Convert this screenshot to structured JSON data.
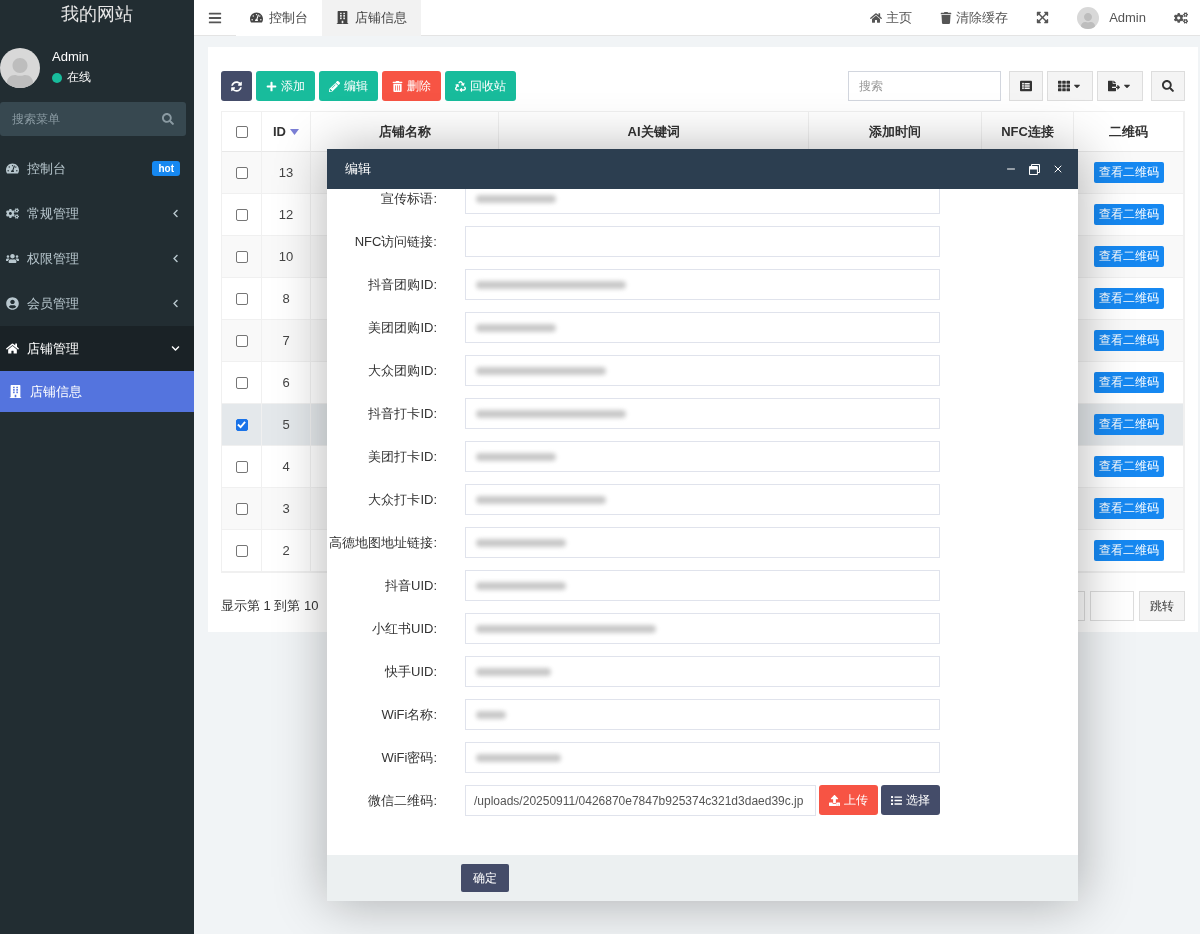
{
  "sidebar": {
    "logo": "我的网站",
    "user": {
      "name": "Admin",
      "status": "在线"
    },
    "search": {
      "placeholder": "搜索菜单"
    },
    "menu": [
      {
        "label": "控制台",
        "kind": "link",
        "badge": "hot"
      },
      {
        "label": "常规管理",
        "kind": "group",
        "expanded": false
      },
      {
        "label": "权限管理",
        "kind": "group",
        "expanded": false
      },
      {
        "label": "会员管理",
        "kind": "group",
        "expanded": false
      },
      {
        "label": "店铺管理",
        "kind": "group",
        "expanded": true,
        "children": [
          {
            "label": "店铺信息",
            "selected": true
          }
        ]
      }
    ]
  },
  "header": {
    "tabs": [
      {
        "label": "控制台",
        "selected": false
      },
      {
        "label": "店铺信息",
        "selected": true
      }
    ],
    "actions": [
      {
        "label": "主页",
        "kind": "home"
      },
      {
        "label": "清除缓存",
        "kind": "trash"
      }
    ],
    "user": "Admin"
  },
  "toolbar": {
    "buttons": [
      {
        "kind": "refresh"
      },
      {
        "kind": "add",
        "label": "添加"
      },
      {
        "kind": "edit",
        "label": "编辑"
      },
      {
        "kind": "delete",
        "label": "删除"
      },
      {
        "kind": "recycle",
        "label": "回收站"
      }
    ],
    "search": {
      "placeholder": "搜索"
    }
  },
  "table": {
    "all_checked": false,
    "columns": [
      {
        "label": "ID",
        "sorted": true
      },
      {
        "label": "店铺名称",
        "sorted": false
      },
      {
        "label": "AI关键词",
        "sorted": false
      },
      {
        "label": "添加时间",
        "sorted": false
      },
      {
        "label": "NFC连接",
        "sorted": false
      },
      {
        "label": "二维码",
        "sorted": false
      }
    ],
    "rows": [
      {
        "id": "13",
        "checked": false,
        "action": "查看二维码"
      },
      {
        "id": "12",
        "checked": false,
        "action": "查看二维码"
      },
      {
        "id": "10",
        "checked": false,
        "action": "查看二维码"
      },
      {
        "id": "8",
        "checked": false,
        "action": "查看二维码"
      },
      {
        "id": "7",
        "checked": false,
        "action": "查看二维码"
      },
      {
        "id": "6",
        "checked": false,
        "action": "查看二维码"
      },
      {
        "id": "5",
        "checked": true,
        "action": "查看二维码"
      },
      {
        "id": "4",
        "checked": false,
        "action": "查看二维码"
      },
      {
        "id": "3",
        "checked": false,
        "action": "查看二维码"
      },
      {
        "id": "2",
        "checked": false,
        "action": "查看二维码"
      }
    ]
  },
  "pagination": {
    "summary": "显示第 1 到第 10",
    "jump": "跳转"
  },
  "modal": {
    "title": "编辑",
    "fields": [
      {
        "label": "宣传标语:",
        "redacted": true
      },
      {
        "label": "NFC访问链接:",
        "redacted": false
      },
      {
        "label": "抖音团购ID:",
        "redacted": true
      },
      {
        "label": "美团团购ID:",
        "redacted": true
      },
      {
        "label": "大众团购ID:",
        "redacted": true
      },
      {
        "label": "抖音打卡ID:",
        "redacted": true
      },
      {
        "label": "美团打卡ID:",
        "redacted": true
      },
      {
        "label": "大众打卡ID:",
        "redacted": true
      },
      {
        "label": "高德地图地址链接:",
        "redacted": true
      },
      {
        "label": "抖音UID:",
        "redacted": true
      },
      {
        "label": "小红书UID:",
        "redacted": true
      },
      {
        "label": "快手UID:",
        "redacted": true
      },
      {
        "label": "WiFi名称:",
        "redacted": true
      },
      {
        "label": "WiFi密码:",
        "redacted": true
      }
    ],
    "file": {
      "label": "微信二维码:",
      "value": "/uploads/20250911/0426870e7847b925374c321d3daed39c.jp",
      "upload": "上传",
      "choose": "选择"
    },
    "submit": "确定"
  }
}
